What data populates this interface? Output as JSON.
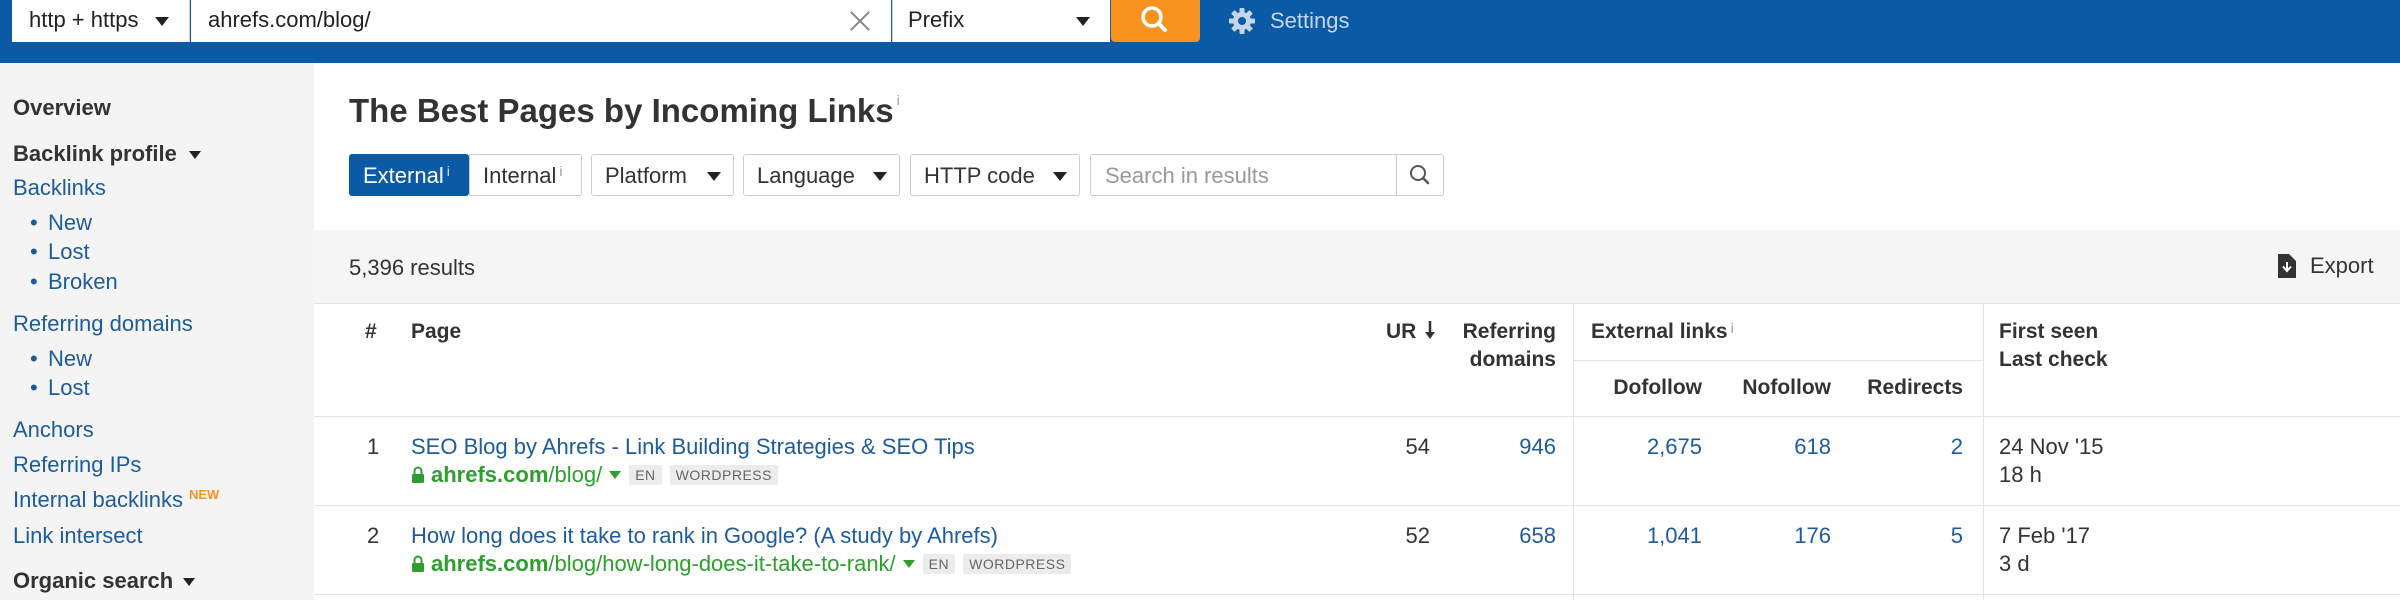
{
  "topbar": {
    "protocol": "http + https",
    "url": "ahrefs.com/blog/",
    "mode": "Prefix",
    "settings_label": "Settings",
    "accent_color": "#f7931e",
    "bar_color": "#0b5aa6"
  },
  "sidebar": {
    "overview": "Overview",
    "backlink_profile": "Backlink profile",
    "backlinks": "Backlinks",
    "backlinks_sub": [
      "New",
      "Lost",
      "Broken"
    ],
    "referring_domains": "Referring domains",
    "referring_domains_sub": [
      "New",
      "Lost"
    ],
    "anchors": "Anchors",
    "referring_ips": "Referring IPs",
    "internal_backlinks": "Internal backlinks",
    "new_badge": "NEW",
    "link_intersect": "Link intersect",
    "organic_search": "Organic search"
  },
  "main": {
    "title": "The Best Pages by Incoming Links",
    "info_mark": "i",
    "filters": {
      "external": "External",
      "internal": "Internal",
      "platform": "Platform",
      "language": "Language",
      "http_code": "HTTP code"
    },
    "search_placeholder": "Search in results",
    "results_count": "5,396 results",
    "export_label": "Export"
  },
  "table": {
    "headers": {
      "index": "#",
      "page": "Page",
      "ur": "UR",
      "referring_domains_1": "Referring",
      "referring_domains_2": "domains",
      "external_links": "External links",
      "dofollow": "Dofollow",
      "nofollow": "Nofollow",
      "redirects": "Redirects",
      "first_seen": "First seen",
      "last_check": "Last check"
    },
    "rows": [
      {
        "index": "1",
        "title": "SEO Blog by Ahrefs - Link Building Strategies & SEO Tips",
        "domain": "ahrefs.com",
        "path": "/blog/",
        "lang": "EN",
        "platform": "WORDPRESS",
        "ur": "54",
        "referring_domains": "946",
        "dofollow": "2,675",
        "nofollow": "618",
        "redirects": "2",
        "first_seen": "24 Nov '15",
        "last_check": "18 h"
      },
      {
        "index": "2",
        "title": "How long does it take to rank in Google? (A study by Ahrefs)",
        "domain": "ahrefs.com",
        "path": "/blog/how-long-does-it-take-to-rank/",
        "lang": "EN",
        "platform": "WORDPRESS",
        "ur": "52",
        "referring_domains": "658",
        "dofollow": "1,041",
        "nofollow": "176",
        "redirects": "5",
        "first_seen": "7 Feb '17",
        "last_check": "3 d"
      }
    ]
  }
}
